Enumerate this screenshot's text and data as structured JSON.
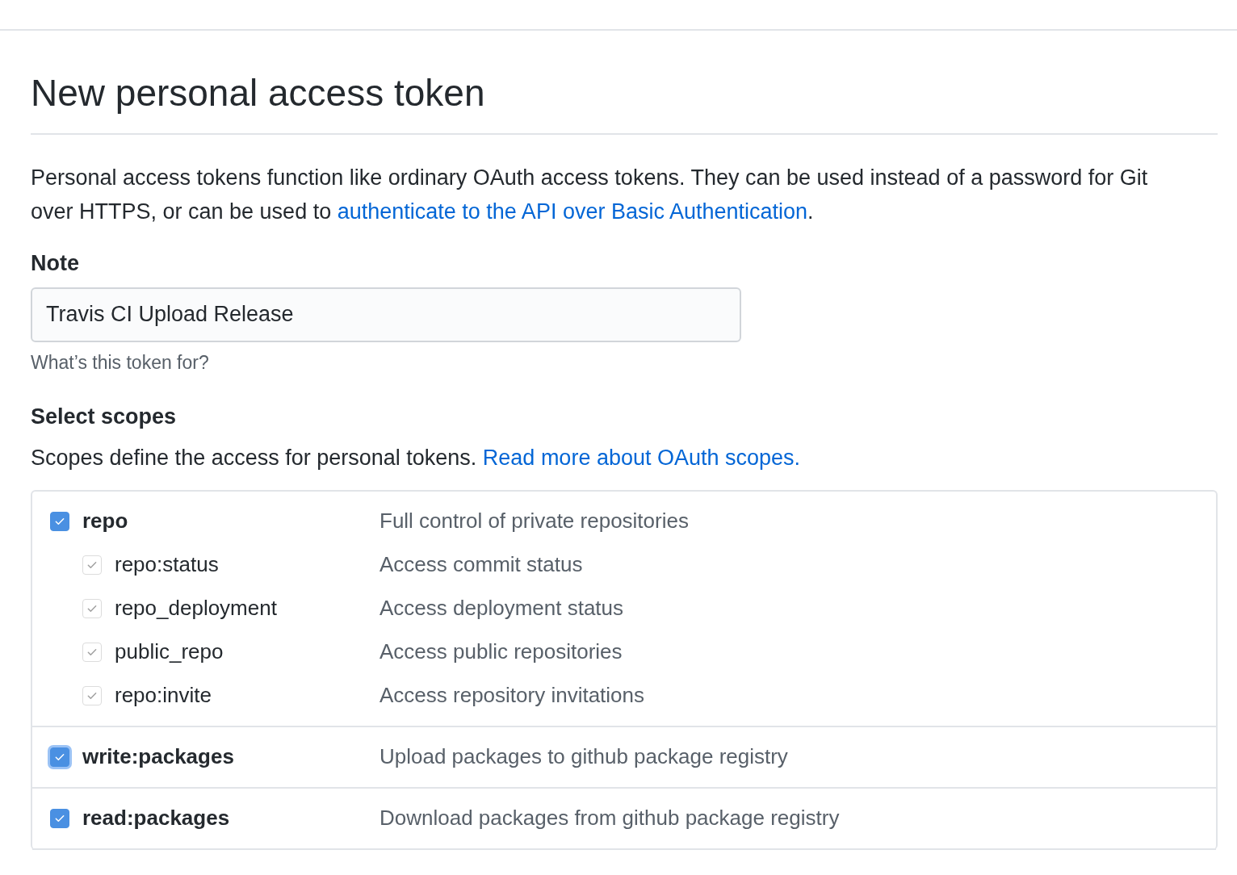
{
  "title": "New personal access token",
  "intro": {
    "text": "Personal access tokens function like ordinary OAuth access tokens. They can be used instead of a password for Git over HTTPS, or can be used to ",
    "link": "authenticate to the API over Basic Authentication",
    "after": "."
  },
  "note": {
    "label": "Note",
    "value": "Travis CI Upload Release",
    "hint": "What’s this token for?"
  },
  "scopes_section": {
    "heading": "Select scopes",
    "text": "Scopes define the access for personal tokens. ",
    "link": "Read more about OAuth scopes."
  },
  "scopes": [
    {
      "name": "repo",
      "description": "Full control of private repositories",
      "checked": true,
      "disabled": false,
      "focused": false,
      "children": [
        {
          "name": "repo:status",
          "description": "Access commit status",
          "checked": true,
          "disabled": true,
          "focused": false
        },
        {
          "name": "repo_deployment",
          "description": "Access deployment status",
          "checked": true,
          "disabled": true,
          "focused": false
        },
        {
          "name": "public_repo",
          "description": "Access public repositories",
          "checked": true,
          "disabled": true,
          "focused": false
        },
        {
          "name": "repo:invite",
          "description": "Access repository invitations",
          "checked": true,
          "disabled": true,
          "focused": false
        }
      ]
    },
    {
      "name": "write:packages",
      "description": "Upload packages to github package registry",
      "checked": true,
      "disabled": false,
      "focused": true
    },
    {
      "name": "read:packages",
      "description": "Download packages from github package registry",
      "checked": true,
      "disabled": false,
      "focused": false
    }
  ]
}
